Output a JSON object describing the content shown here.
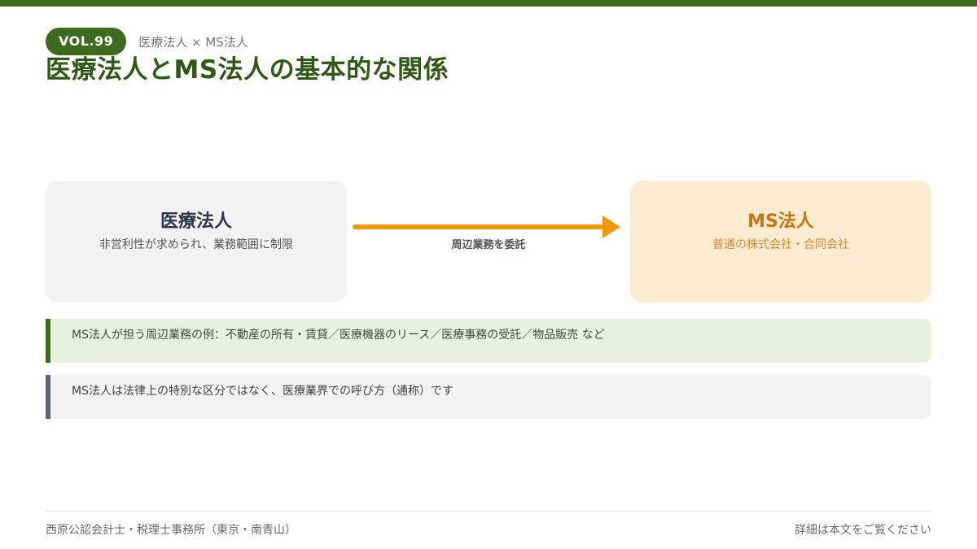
{
  "header": {
    "volume": "VOL.99",
    "subtitle": "医療法人 × MS法人",
    "title": "医療法人とMS法人の基本的な関係"
  },
  "diagram": {
    "left_box": {
      "title": "医療法人",
      "description": "非営利性が求められ、業務範囲に制限"
    },
    "arrow_label": "周辺業務を委託",
    "right_box": {
      "title": "MS法人",
      "description": "普通の株式会社・合同会社"
    }
  },
  "notes": [
    "MS法人が担う周辺業務の例：不動産の所有・賃貸／医療機器のリース／医療事務の受託／物品販売 など",
    "MS法人は法律上の特別な区分ではなく、医療業界での呼び方（通称）です"
  ],
  "footer": {
    "left": "西原公認会計士・税理士事務所（東京・南青山）",
    "right": "詳細は本文をご覧ください"
  },
  "colors": {
    "brand_green": "#3d6b1f",
    "title_green": "#2f5a16",
    "arrow_orange": "#ef9a0b",
    "right_box_bg": "#fdebd2",
    "right_box_text": "#c8730e"
  }
}
